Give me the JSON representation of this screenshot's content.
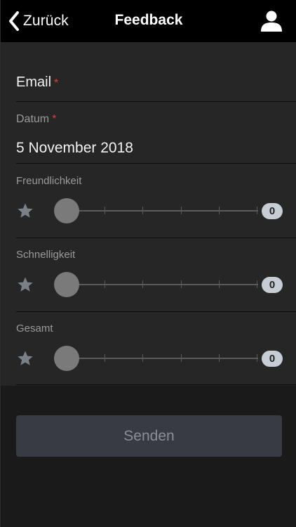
{
  "header": {
    "back_label": "Zurück",
    "title": "Feedback",
    "user_icon": "user-icon"
  },
  "form": {
    "email": {
      "label": "Email",
      "required_mark": "*",
      "value": ""
    },
    "date": {
      "label": "Datum",
      "required_mark": "*",
      "value": "5 November 2018"
    },
    "ratings": [
      {
        "label": "Freundlichkeit",
        "value": "0",
        "icon": "star-icon"
      },
      {
        "label": "Schnelligkeit",
        "value": "0",
        "icon": "star-icon"
      },
      {
        "label": "Gesamt",
        "value": "0",
        "icon": "star-icon"
      }
    ]
  },
  "submit_label": "Senden",
  "colors": {
    "header_bg": "#000000",
    "panel_bg": "#262626",
    "page_bg": "#1a1a1a",
    "required": "#e53935",
    "badge_bg": "#c7cdd4",
    "button_bg": "#383c42"
  }
}
